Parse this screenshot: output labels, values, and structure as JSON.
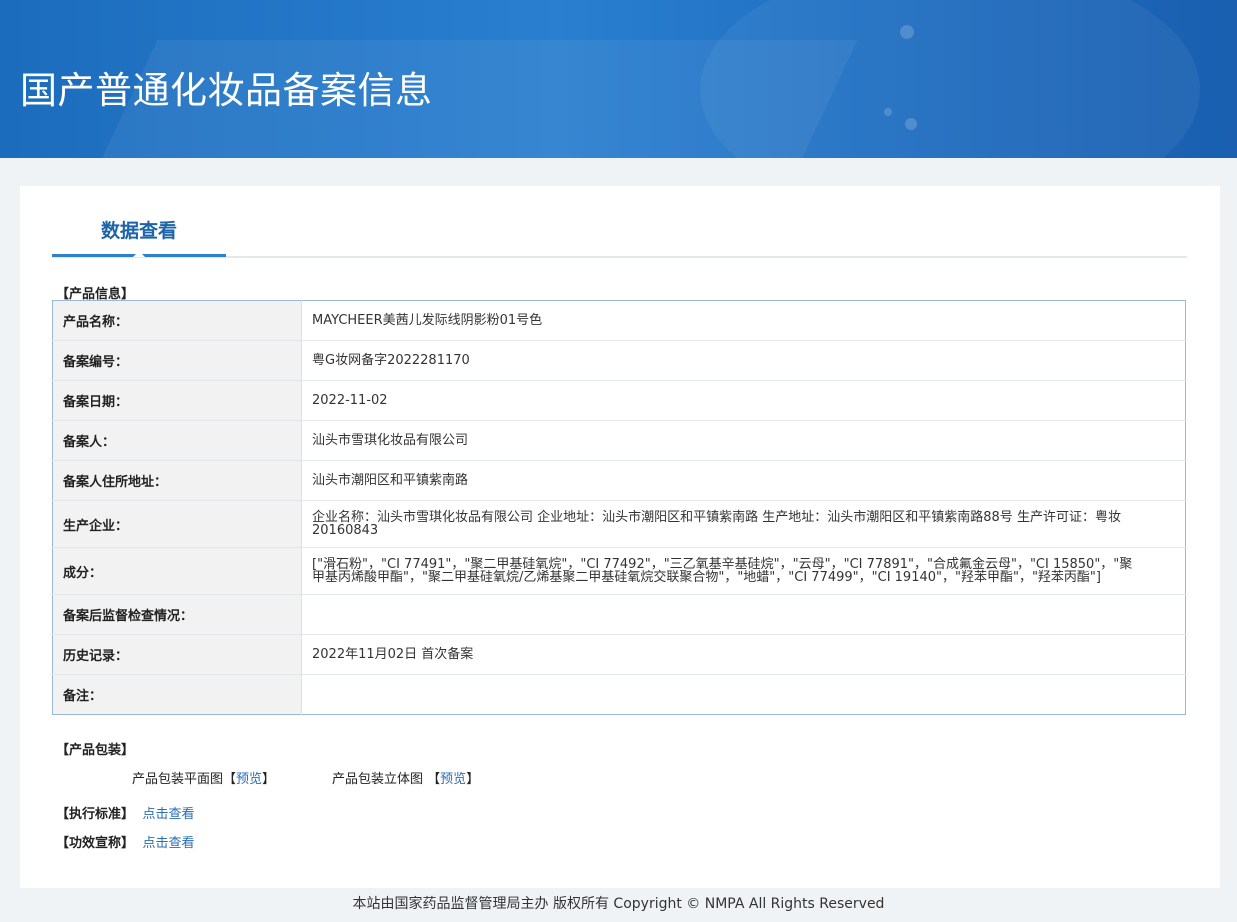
{
  "page_title": "国产普通化妆品备案信息",
  "tab_label": "数据查看",
  "product_info": {
    "section_title": "【产品信息】",
    "rows": [
      {
        "key": "产品名称：",
        "value": "MAYCHEER美茜儿发际线阴影粉01号色"
      },
      {
        "key": "备案编号：",
        "value": "粤G妆网备字2022281170"
      },
      {
        "key": "备案日期：",
        "value": "2022-11-02"
      },
      {
        "key": "备案人：",
        "value": "汕头市雪琪化妆品有限公司"
      },
      {
        "key": "备案人住所地址：",
        "value": "汕头市潮阳区和平镇紫南路"
      },
      {
        "key": "生产企业：",
        "value": "企业名称：汕头市雪琪化妆品有限公司 企业地址：汕头市潮阳区和平镇紫南路 生产地址：汕头市潮阳区和平镇紫南路88号 生产许可证：粤妆20160843"
      },
      {
        "key": "成分：",
        "value": "[\"滑石粉\"，\"CI 77491\"，\"聚二甲基硅氧烷\"，\"CI 77492\"，\"三乙氧基辛基硅烷\"，\"云母\"，\"CI 77891\"，\"合成氟金云母\"，\"CI 15850\"，\"聚甲基丙烯酸甲酯\"，\"聚二甲基硅氧烷/乙烯基聚二甲基硅氧烷交联聚合物\"，\"地蜡\"，\"CI 77499\"，\"CI 19140\"，\"羟苯甲酯\"，\"羟苯丙酯\"]"
      },
      {
        "key": "备案后监督检查情况：",
        "value": ""
      },
      {
        "key": "历史记录：",
        "value": "2022年11月02日 首次备案"
      },
      {
        "key": "备注：",
        "value": ""
      }
    ]
  },
  "packaging": {
    "section_title": "【产品包装】",
    "flat_label": "产品包装平面图",
    "flat_link": "预览",
    "stereo_label": "产品包装立体图",
    "stereo_link": "预览",
    "bracket_open": "【",
    "bracket_close": "】"
  },
  "standard": {
    "section_title": "【执行标准】",
    "link": "点击查看"
  },
  "efficacy": {
    "section_title": "【功效宣称】",
    "link": "点击查看"
  },
  "footer": "本站由国家药品监督管理局主办 版权所有 Copyright © NMPA All Rights Reserved"
}
